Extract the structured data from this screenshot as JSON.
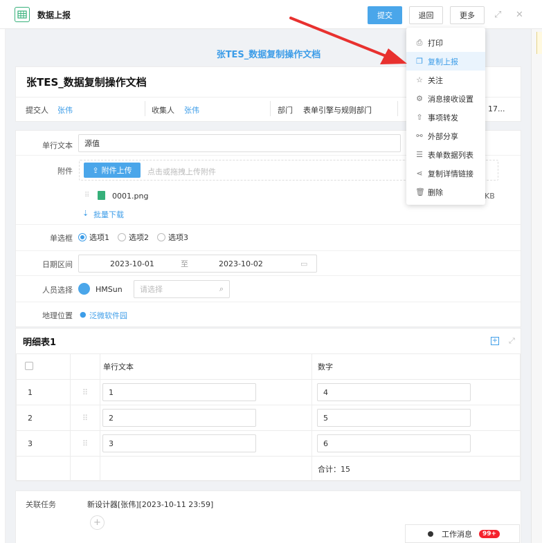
{
  "header": {
    "app_title": "数据上报",
    "submit_label": "提交",
    "back_label": "退回",
    "more_label": "更多"
  },
  "document": {
    "heading": "张TES_数据复制操作文档",
    "card_title": "张TES_数据复制操作文档",
    "submitter_label": "提交人",
    "submitter": "张伟",
    "collector_label": "收集人",
    "collector": "张伟",
    "dept_label": "部门",
    "dept": "表单引擎与规则部门",
    "date_partial": "17..."
  },
  "form": {
    "text_label": "单行文本",
    "text_value": "源值",
    "attach_label": "附件",
    "upload_label": "附件上传",
    "upload_hint": "点击或拖拽上传附件",
    "file_name": "0001.png",
    "file_size_partial": "KB",
    "batch_download": "批量下载",
    "radio_label": "单选框",
    "radio_options": [
      "选项1",
      "选项2",
      "选项3"
    ],
    "date_label": "日期区间",
    "date_start": "2023-10-01",
    "date_sep": "至",
    "date_end": "2023-10-02",
    "person_label": "人员选择",
    "person_name": "HMSun",
    "person_placeholder": "请选择",
    "location_label": "地理位置",
    "location_value": "泛微软件园"
  },
  "detail": {
    "title": "明细表1",
    "col_text": "单行文本",
    "col_number": "数字",
    "rows": [
      {
        "index": "1",
        "text": "1",
        "number": "4"
      },
      {
        "index": "2",
        "text": "2",
        "number": "5"
      },
      {
        "index": "3",
        "text": "3",
        "number": "6"
      }
    ],
    "total": "合计：15"
  },
  "related": {
    "label": "关联任务",
    "task": "新设计器[张伟][2023-10-11 23:59]"
  },
  "menu": {
    "items": [
      {
        "label": "打印",
        "icon": "printer-icon"
      },
      {
        "label": "复制上报",
        "icon": "copy-icon"
      },
      {
        "label": "关注",
        "icon": "star-icon"
      },
      {
        "label": "消息接收设置",
        "icon": "gear-icon"
      },
      {
        "label": "事项转发",
        "icon": "forward-icon"
      },
      {
        "label": "外部分享",
        "icon": "share-icon"
      },
      {
        "label": "表单数据列表",
        "icon": "list-icon"
      },
      {
        "label": "复制详情链接",
        "icon": "link-icon"
      },
      {
        "label": "删除",
        "icon": "trash-icon"
      }
    ]
  },
  "notice": {
    "label": "工作消息",
    "count": "99+"
  },
  "colors": {
    "primary": "#4aa6ea",
    "link": "#3d9de8",
    "arrow": "#e8312f",
    "badge": "#f5222d"
  }
}
